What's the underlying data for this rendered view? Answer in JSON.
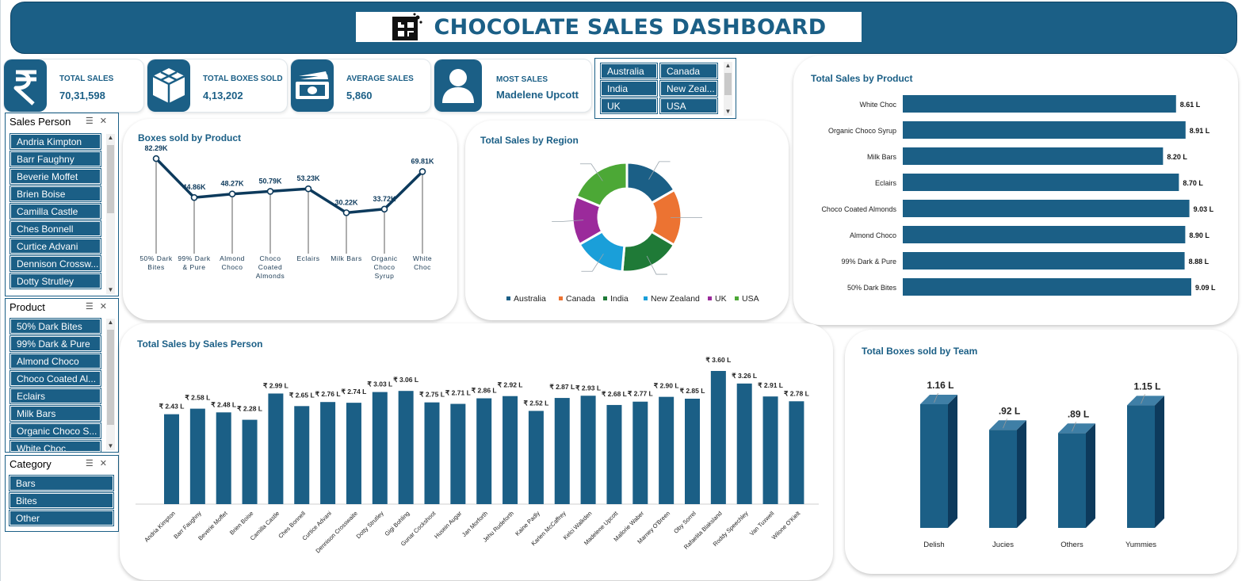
{
  "title": "CHOCOLATE SALES DASHBOARD",
  "colors": {
    "primary": "#1b5f86",
    "dark": "#0d3a5c",
    "australia": "#1b5f86",
    "canada": "#ec7332",
    "india": "#1f7a37",
    "new_zealand": "#1a9fd9",
    "uk": "#9b2a9b",
    "usa": "#4ca836"
  },
  "kpis": [
    {
      "icon": "rupee-icon",
      "label": "TOTAL SALES",
      "value": "70,31,598"
    },
    {
      "icon": "boxes-icon",
      "label": "TOTAL BOXES SOLD",
      "value": "4,13,202"
    },
    {
      "icon": "banknotes-icon",
      "label": "AVERAGE SALES",
      "value": "5,860"
    },
    {
      "icon": "user-icon",
      "label": "MOST SALES",
      "value": "Madelene Upcott"
    }
  ],
  "country_slicer": {
    "items": [
      "Australia",
      "Canada",
      "India",
      "New Zeal...",
      "UK",
      "USA"
    ]
  },
  "sales_person_slicer": {
    "header": "Sales Person",
    "items": [
      "Andria Kimpton",
      "Barr Faughny",
      "Beverie Moffet",
      "Brien Boise",
      "Camilla Castle",
      "Ches Bonnell",
      "Curtice Advani",
      "Dennison Crossw...",
      "Dotty Strutley"
    ]
  },
  "product_slicer": {
    "header": "Product",
    "items": [
      "50% Dark Bites",
      "99% Dark & Pure",
      "Almond Choco",
      "Choco Coated Al...",
      "Eclairs",
      "Milk Bars",
      "Organic Choco S...",
      "White Choc"
    ]
  },
  "category_slicer": {
    "header": "Category",
    "items": [
      "Bars",
      "Bites",
      "Other"
    ]
  },
  "chart_data": [
    {
      "id": "boxes_by_product",
      "type": "line",
      "title": "Boxes sold by Product",
      "categories": [
        "50% Dark Bites",
        "99% Dark & Pure",
        "Almond Choco",
        "Choco Coated Almonds",
        "Eclairs",
        "Milk Bars",
        "Organic Choco Syrup",
        "White Choc"
      ],
      "values": [
        82.29,
        44.86,
        48.27,
        50.79,
        53.23,
        30.22,
        33.72,
        69.81
      ],
      "labels": [
        "82.29K",
        "44.86K",
        "48.27K",
        "50.79K",
        "53.23K",
        "30.22K",
        "33.72K",
        "69.81K"
      ],
      "unit": "K"
    },
    {
      "id": "sales_by_region",
      "type": "pie",
      "title": "Total Sales by Region",
      "categories": [
        "Australia",
        "Canada",
        "India",
        "New Zealand",
        "UK",
        "USA"
      ],
      "values": [
        16.7,
        16.8,
        17.9,
        15.3,
        14.5,
        18.8
      ],
      "legend": "bottom"
    },
    {
      "id": "sales_by_product",
      "type": "bar",
      "orientation": "horizontal",
      "title": "Total Sales by Product",
      "categories": [
        "White Choc",
        "Organic Choco Syrup",
        "Milk Bars",
        "Eclairs",
        "Choco Coated Almonds",
        "Almond Choco",
        "99% Dark & Pure",
        "50% Dark Bites"
      ],
      "values": [
        8.61,
        8.91,
        8.2,
        8.7,
        9.03,
        8.9,
        8.88,
        9.09
      ],
      "labels": [
        "8.61 L",
        "8.91 L",
        "8.20 L",
        "8.70 L",
        "9.03 L",
        "8.90 L",
        "8.88 L",
        "9.09 L"
      ],
      "unit": "L"
    },
    {
      "id": "sales_by_person",
      "type": "bar",
      "title": "Total Sales by Sales Person",
      "categories": [
        "Andria Kimpton",
        "Barr Faughny",
        "Beverie Moffet",
        "Brien Boise",
        "Camilla Castle",
        "Ches Bonnell",
        "Curtice Advani",
        "Dennison Crosswaite",
        "Dotty Strutley",
        "Gigi Bohling",
        "Gunar Cockshoot",
        "Husein Augar",
        "Jan Morforth",
        "Jehu Rudeforth",
        "Kaine Padly",
        "Karlen McCaffrey",
        "Kelci Walkden",
        "Madelene Upcott",
        "Mallorie Waber",
        "Marney O'Breen",
        "Oby Sorrel",
        "Rafaelita Blaksland",
        "Roddy Speechley",
        "Van Tuxwell",
        "Wilone O'Kielt"
      ],
      "values": [
        2.43,
        2.58,
        2.48,
        2.28,
        2.99,
        2.65,
        2.76,
        2.74,
        3.03,
        3.06,
        2.75,
        2.71,
        2.86,
        2.92,
        2.52,
        2.87,
        2.93,
        2.68,
        2.77,
        2.9,
        2.85,
        3.6,
        3.26,
        2.91,
        2.78
      ],
      "labels": [
        "₹ 2.43 L",
        "₹ 2.58 L",
        "₹ 2.48 L",
        "₹ 2.28 L",
        "₹ 2.99 L",
        "₹ 2.65 L",
        "₹ 2.76 L",
        "₹ 2.74 L",
        "₹ 3.03 L",
        "₹ 3.06 L",
        "₹ 2.75 L",
        "₹ 2.71 L",
        "₹ 2.86 L",
        "₹ 2.92 L",
        "₹ 2.52 L",
        "₹ 2.87 L",
        "₹ 2.93 L",
        "₹ 2.68 L",
        "₹ 2.77 L",
        "₹ 2.90 L",
        "₹ 2.85 L",
        "₹ 3.60 L",
        "₹ 3.26 L",
        "₹ 2.91 L",
        "₹ 2.78 L"
      ],
      "unit": "₹ L"
    },
    {
      "id": "boxes_by_team",
      "type": "bar",
      "style": "3d-column",
      "title": "Total Boxes sold by Team",
      "categories": [
        "Delish",
        "Jucies",
        "Others",
        "Yummies"
      ],
      "values": [
        1.16,
        0.92,
        0.89,
        1.15
      ],
      "labels": [
        "1.16 L",
        ".92 L",
        ".89 L",
        "1.15 L"
      ],
      "unit": "L"
    }
  ]
}
